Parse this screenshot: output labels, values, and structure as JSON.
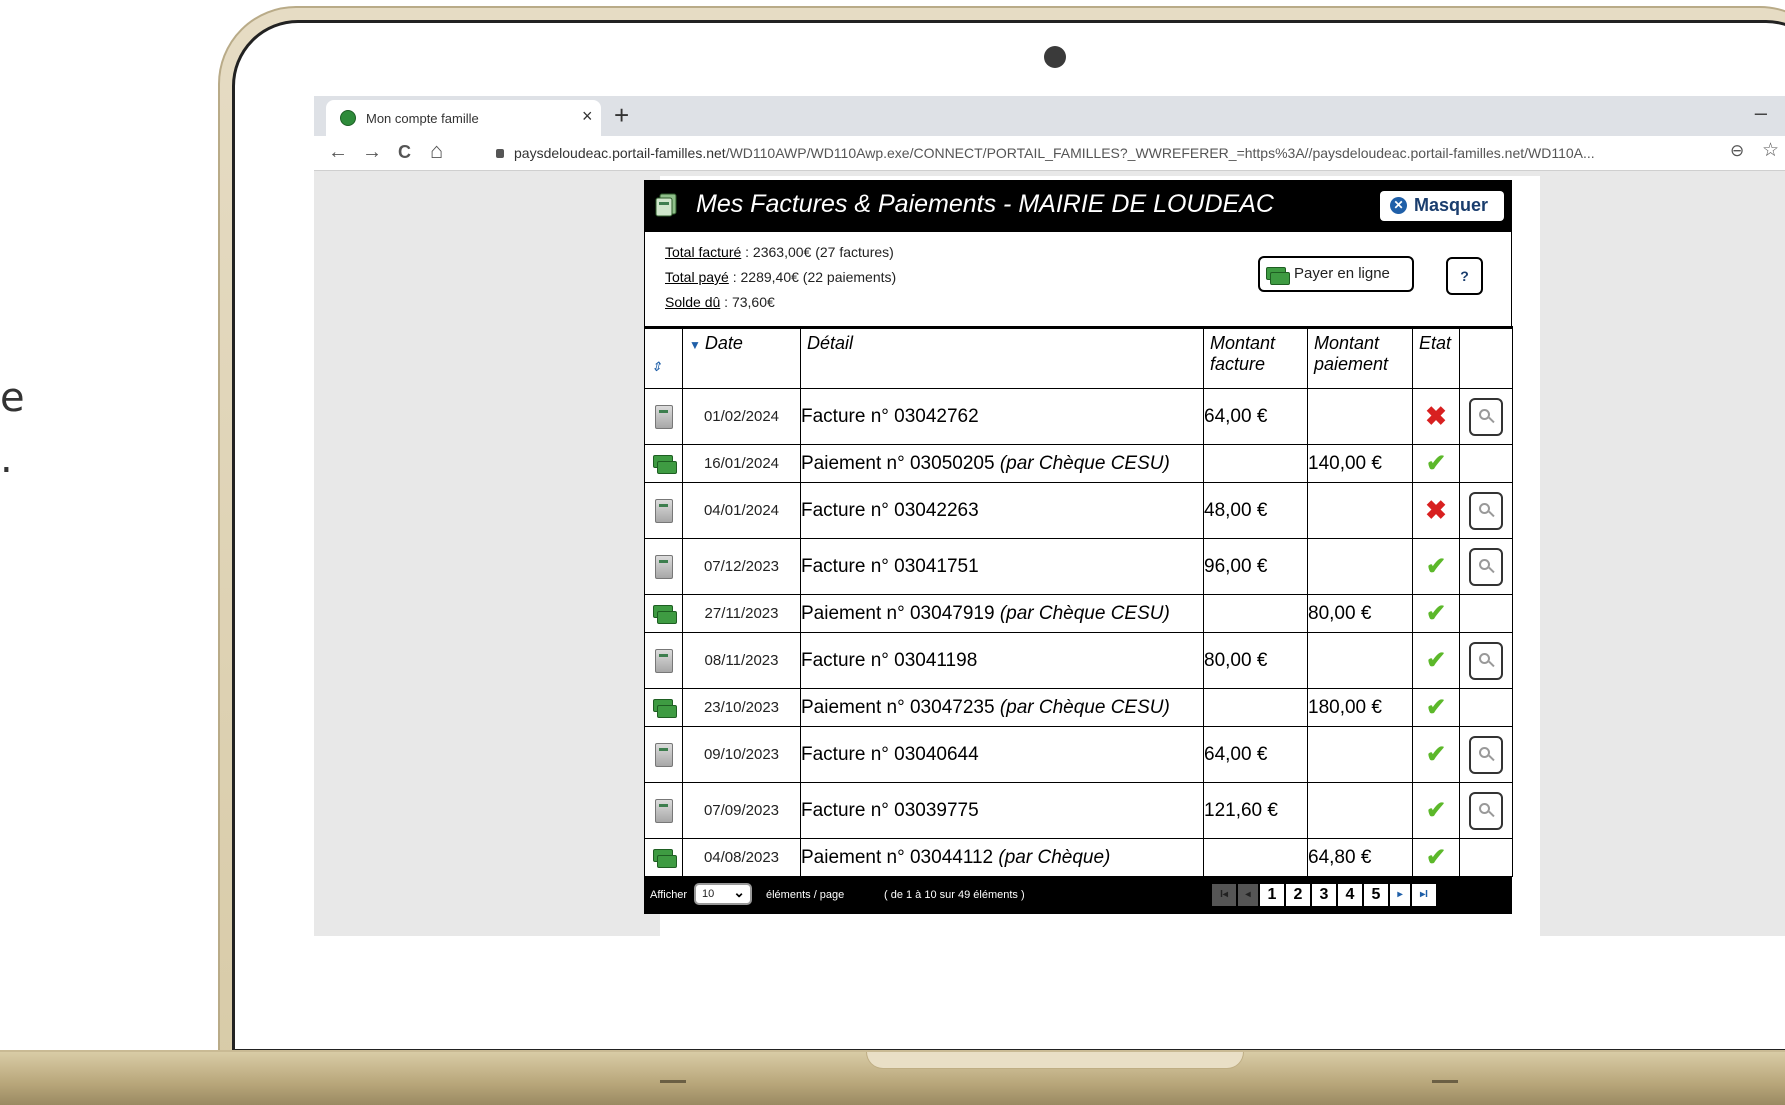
{
  "slide_fragments": [
    "e",
    "."
  ],
  "browser": {
    "tab_title": "Mon compte famille",
    "tab_close": "×",
    "new_tab": "+",
    "minimize": "–",
    "back": "←",
    "forward": "→",
    "reload": "C",
    "home": "⌂",
    "url_host": "paysdeloudeac.portail-familles.net",
    "url_path": "/WD110AWP/WD110Awp.exe/CONNECT/PORTAIL_FAMILLES?_WWREFERER_=https%3A//paysdeloudeac.portail-familles.net/WD110A...",
    "zoom": "⊖",
    "bookmark": "☆"
  },
  "panel": {
    "title": "Mes Factures & Paiements - MAIRIE DE LOUDEAC",
    "hide_label": "Masquer",
    "total_facture_label": "Total facturé",
    "total_facture_value": " : 2363,00€ (27 factures)",
    "total_paye_label": "Total payé",
    "total_paye_value": " : 2289,40€ (22 paiements)",
    "solde_label": "Solde dû",
    "solde_value": " : 73,60€",
    "pay_online_label": "Payer en ligne",
    "help_label": "?"
  },
  "table": {
    "columns": {
      "sort": "⇕",
      "date": "Date",
      "detail": "Détail",
      "montant_facture": "Montant facture",
      "montant_paiement": "Montant paiement",
      "etat": "Etat"
    },
    "rows": [
      {
        "type": "invoice",
        "date": "01/02/2024",
        "label": "Facture n° 03042762",
        "mode": "",
        "facture": "64,00 €",
        "paiement": "",
        "status": "unpaid"
      },
      {
        "type": "payment",
        "date": "16/01/2024",
        "label": "Paiement n° 03050205 ",
        "mode": "(par Chèque CESU)",
        "facture": "",
        "paiement": "140,00 €",
        "status": "ok"
      },
      {
        "type": "invoice",
        "date": "04/01/2024",
        "label": "Facture n° 03042263",
        "mode": "",
        "facture": "48,00 €",
        "paiement": "",
        "status": "unpaid"
      },
      {
        "type": "invoice",
        "date": "07/12/2023",
        "label": "Facture n° 03041751",
        "mode": "",
        "facture": "96,00 €",
        "paiement": "",
        "status": "ok"
      },
      {
        "type": "payment",
        "date": "27/11/2023",
        "label": "Paiement n° 03047919 ",
        "mode": "(par Chèque CESU)",
        "facture": "",
        "paiement": "80,00 €",
        "status": "ok"
      },
      {
        "type": "invoice",
        "date": "08/11/2023",
        "label": "Facture n° 03041198",
        "mode": "",
        "facture": "80,00 €",
        "paiement": "",
        "status": "ok"
      },
      {
        "type": "payment",
        "date": "23/10/2023",
        "label": "Paiement n° 03047235 ",
        "mode": "(par Chèque CESU)",
        "facture": "",
        "paiement": "180,00 €",
        "status": "ok"
      },
      {
        "type": "invoice",
        "date": "09/10/2023",
        "label": "Facture n° 03040644",
        "mode": "",
        "facture": "64,00 €",
        "paiement": "",
        "status": "ok"
      },
      {
        "type": "invoice",
        "date": "07/09/2023",
        "label": "Facture n° 03039775",
        "mode": "",
        "facture": "121,60 €",
        "paiement": "",
        "status": "ok"
      },
      {
        "type": "payment",
        "date": "04/08/2023",
        "label": "Paiement n° 03044112 ",
        "mode": "(par Chèque)",
        "facture": "",
        "paiement": "64,80 €",
        "status": "ok"
      }
    ]
  },
  "footer": {
    "afficher": "Afficher",
    "per_page": "10",
    "elements": "éléments / page",
    "range": "( de 1 à 10 sur 49 éléments )",
    "pages": [
      "1",
      "2",
      "3",
      "4",
      "5"
    ],
    "first": "I◂",
    "prev": "◂",
    "next": "▸",
    "last": "▸I"
  },
  "colors": {
    "accent_blue": "#1f5fa8",
    "unpaid_red": "#d82020",
    "paid_green": "#5cb82a",
    "laptop_gold": "#d8cba8"
  }
}
